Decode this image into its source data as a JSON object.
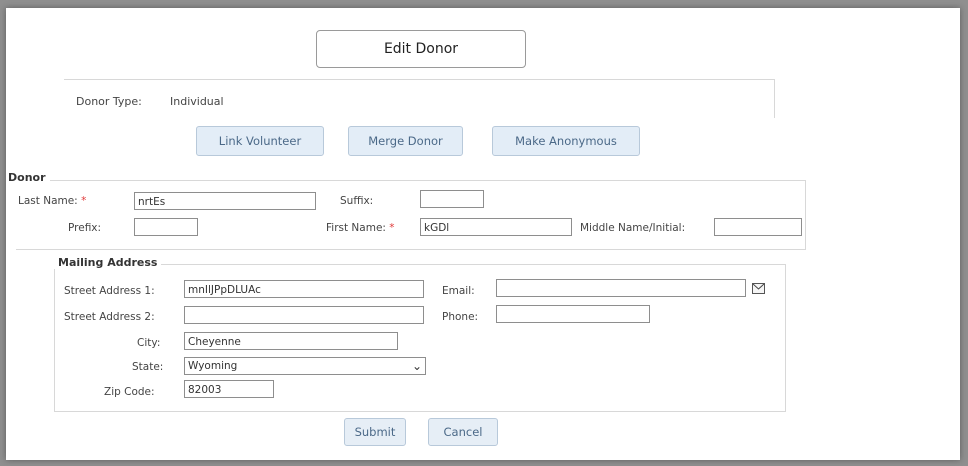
{
  "header": {
    "title": "Edit Donor"
  },
  "donor_type": {
    "label": "Donor Type:",
    "value": "Individual"
  },
  "actions": {
    "link_volunteer": "Link Volunteer",
    "merge_donor": "Merge Donor",
    "make_anonymous": "Make Anonymous"
  },
  "donor": {
    "legend": "Donor",
    "last_name_label": "Last Name:",
    "last_name_value": "nrtEs",
    "suffix_label": "Suffix:",
    "suffix_value": "",
    "prefix_label": "Prefix:",
    "prefix_value": "",
    "first_name_label": "First Name:",
    "first_name_value": "kGDl",
    "middle_label": "Middle Name/Initial:",
    "middle_value": "",
    "required_mark": "*"
  },
  "mailing": {
    "legend": "Mailing Address",
    "street1_label": "Street Address 1:",
    "street1_value": "mnIlJPpDLUAc",
    "street2_label": "Street Address 2:",
    "street2_value": "",
    "city_label": "City:",
    "city_value": "Cheyenne",
    "state_label": "State:",
    "state_value": "Wyoming",
    "zip_label": "Zip Code:",
    "zip_value": "82003",
    "email_label": "Email:",
    "email_value": "",
    "phone_label": "Phone:",
    "phone_value": ""
  },
  "footer": {
    "submit": "Submit",
    "cancel": "Cancel"
  },
  "colors": {
    "button_bg": "#e3edf7",
    "button_text": "#4b6988",
    "required": "#e03a3a"
  }
}
